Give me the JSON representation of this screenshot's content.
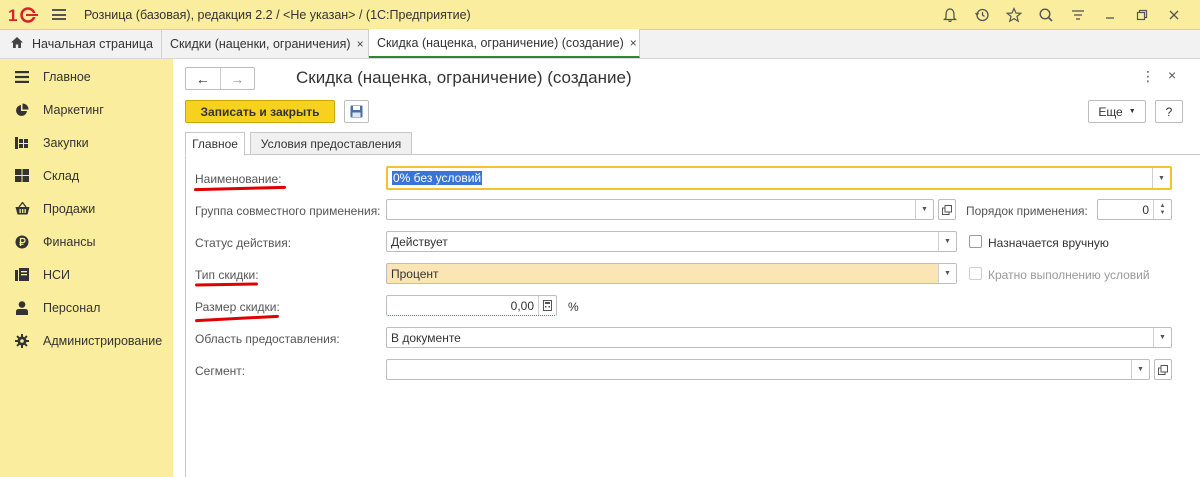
{
  "app": {
    "title": "Розница (базовая), редакция 2.2 / <Не указан> /  (1С:Предприятие)"
  },
  "tabs": [
    {
      "label": "Начальная страница"
    },
    {
      "label": "Скидки (наценки, ограничения)",
      "close": "×"
    },
    {
      "label": "Скидка (наценка, ограничение) (создание)",
      "close": "×"
    }
  ],
  "sidebar": {
    "items": [
      {
        "label": "Главное",
        "icon": "list-icon"
      },
      {
        "label": "Маркетинг",
        "icon": "pie-chart-icon"
      },
      {
        "label": "Закупки",
        "icon": "purchases-icon"
      },
      {
        "label": "Склад",
        "icon": "warehouse-icon"
      },
      {
        "label": "Продажи",
        "icon": "basket-icon"
      },
      {
        "label": "Финансы",
        "icon": "ruble-icon"
      },
      {
        "label": "НСИ",
        "icon": "reference-icon"
      },
      {
        "label": "Персонал",
        "icon": "person-icon"
      },
      {
        "label": "Администрирование",
        "icon": "gear-icon"
      }
    ]
  },
  "form": {
    "title": "Скидка (наценка, ограничение) (создание)",
    "save_close_label": "Записать и закрыть",
    "more_label": "Еще",
    "help_label": "?",
    "tabs": [
      {
        "label": "Главное"
      },
      {
        "label": "Условия предоставления"
      }
    ],
    "fields": {
      "name": {
        "label": "Наименование:",
        "value": "0% без условий"
      },
      "group": {
        "label": "Группа совместного применения:",
        "value": ""
      },
      "order": {
        "label": "Порядок применения:",
        "value": "0"
      },
      "status": {
        "label": "Статус действия:",
        "value": "Действует"
      },
      "manual": {
        "label": "Назначается вручную"
      },
      "type": {
        "label": "Тип скидки:",
        "value": "Процент"
      },
      "multiple": {
        "label": "Кратно выполнению условий"
      },
      "size": {
        "label": "Размер скидки:",
        "value": "0,00",
        "unit": "%"
      },
      "area": {
        "label": "Область предоставления:",
        "value": "В документе"
      },
      "segment": {
        "label": "Сегмент:",
        "value": ""
      }
    }
  },
  "colors": {
    "accent_yellow": "#fbed9e",
    "save_button": "#f6d11e",
    "annotation_red": "#e00000",
    "active_tab_green": "#2b8a2b"
  }
}
